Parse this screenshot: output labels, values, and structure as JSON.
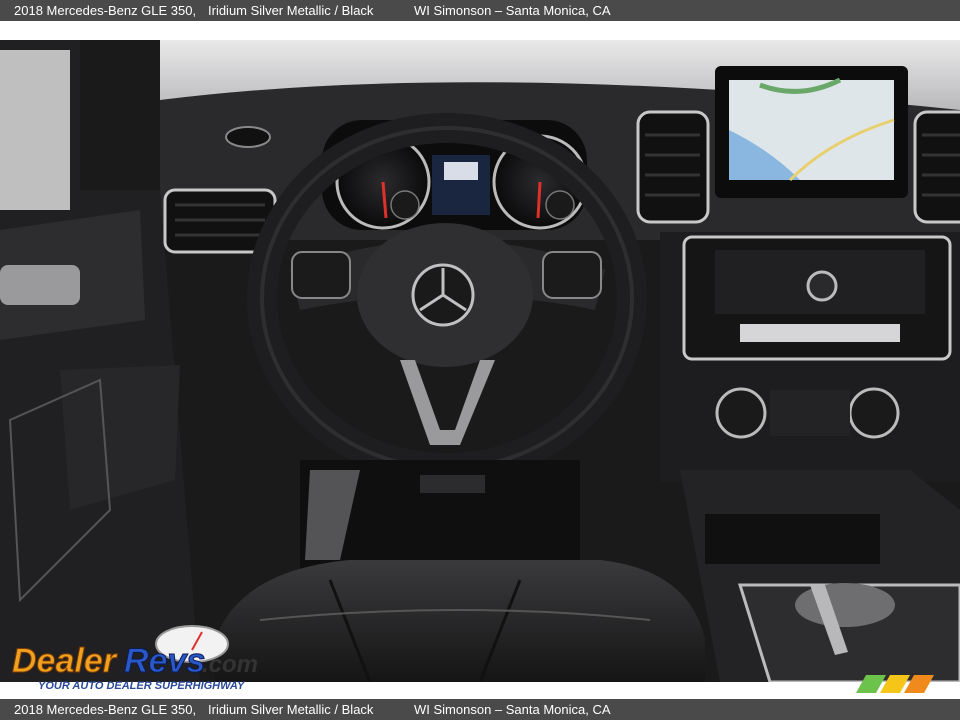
{
  "caption": {
    "vehicle": "2018 Mercedes-Benz GLE 350,",
    "color": "Iridium Silver Metallic / Black",
    "dealer": "WI Simonson – Santa Monica, CA"
  },
  "watermark": {
    "brand": "DealerRevs.com",
    "tagline": "YOUR AUTO DEALER SUPERHIGHWAY"
  },
  "photo": {
    "subject": "dashboard-interior",
    "colors": {
      "leather": "#1c1c1e",
      "trim": "#c8c8c8",
      "screen": "#dfe6ea",
      "dial": "#111",
      "needle": "#e0302a"
    }
  }
}
